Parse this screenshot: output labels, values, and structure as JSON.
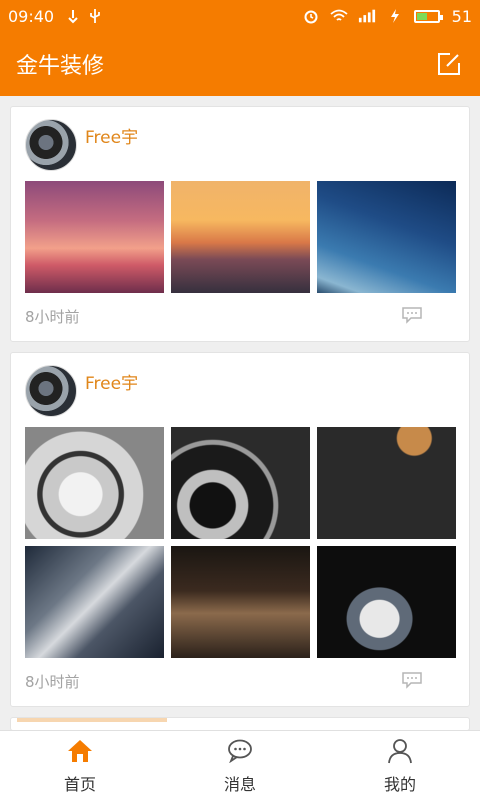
{
  "status_bar": {
    "time": "09:40",
    "battery_level": "51",
    "battery_fill": 0.51,
    "icons": [
      "usb-debug-icon",
      "usb-icon",
      "alarm-icon",
      "wifi-icon",
      "signal-icon",
      "charging-icon",
      "battery-icon"
    ]
  },
  "app_bar": {
    "title": "金牛装修",
    "action_icon": "edit-icon"
  },
  "feed": {
    "posts": [
      {
        "username": "Free宇",
        "time_ago": "8小时前",
        "photos": [
          "sunset-sea-photo",
          "sunset-clouds-photo",
          "starry-sky-photo"
        ]
      },
      {
        "username": "Free宇",
        "time_ago": "8小时前",
        "photos": [
          "camera-lens-photo",
          "motorcycle-engine-photo",
          "spoons-spices-photo",
          "golf-clubs-photo",
          "interior-chair-photo",
          "feather-photo"
        ]
      }
    ]
  },
  "tab_bar": {
    "tabs": [
      {
        "label": "首页",
        "icon": "home-icon",
        "active": true
      },
      {
        "label": "消息",
        "icon": "chat-icon",
        "active": false
      },
      {
        "label": "我的",
        "icon": "user-icon",
        "active": false
      }
    ],
    "active_color": "#f57c00"
  },
  "colors": {
    "primary": "#f57c00",
    "username": "#e0861a",
    "meta_text": "#a3a3a3"
  }
}
